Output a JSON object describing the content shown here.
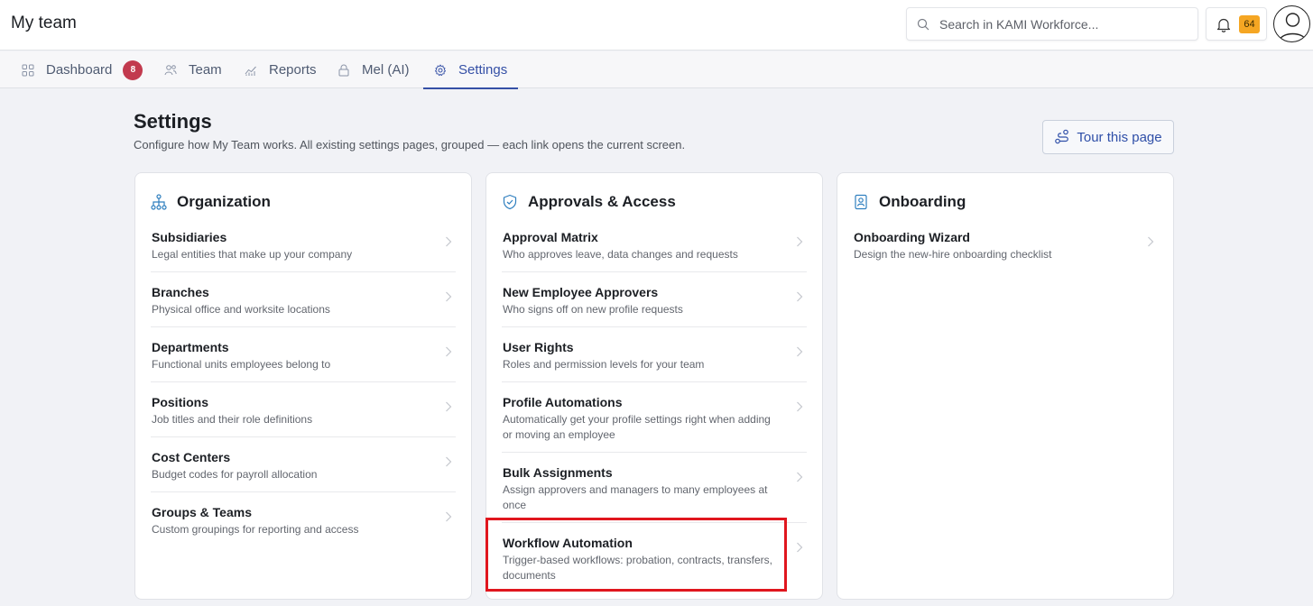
{
  "app": {
    "title": "My team"
  },
  "search": {
    "placeholder": "Search in KAMI Workforce..."
  },
  "notifications": {
    "count": "64"
  },
  "tabs": [
    {
      "label": "Dashboard",
      "icon": "grid-icon",
      "badge": "8"
    },
    {
      "label": "Team",
      "icon": "people-icon"
    },
    {
      "label": "Reports",
      "icon": "bar-chart-icon"
    },
    {
      "label": "Mel (AI)",
      "icon": "lock-icon"
    },
    {
      "label": "Settings",
      "icon": "gear-icon",
      "active": true
    }
  ],
  "page": {
    "title": "Settings",
    "subtitle": "Configure how My Team works. All existing settings pages, grouped — each link opens the current screen.",
    "tour_label": "Tour this page"
  },
  "cards": [
    {
      "title": "Organization",
      "icon": "org-chart-icon",
      "items": [
        {
          "title": "Subsidiaries",
          "desc": "Legal entities that make up your company"
        },
        {
          "title": "Branches",
          "desc": "Physical office and worksite locations"
        },
        {
          "title": "Departments",
          "desc": "Functional units employees belong to"
        },
        {
          "title": "Positions",
          "desc": "Job titles and their role definitions"
        },
        {
          "title": "Cost Centers",
          "desc": "Budget codes for payroll allocation"
        },
        {
          "title": "Groups & Teams",
          "desc": "Custom groupings for reporting and access"
        }
      ]
    },
    {
      "title": "Approvals & Access",
      "icon": "shield-check-icon",
      "items": [
        {
          "title": "Approval Matrix",
          "desc": "Who approves leave, data changes and requests"
        },
        {
          "title": "New Employee Approvers",
          "desc": "Who signs off on new profile requests"
        },
        {
          "title": "User Rights",
          "desc": "Roles and permission levels for your team"
        },
        {
          "title": "Profile Automations",
          "desc": "Automatically get your profile settings right when adding or moving an employee"
        },
        {
          "title": "Bulk Assignments",
          "desc": "Assign approvers and managers to many employees at once"
        },
        {
          "title": "Workflow Automation",
          "desc": "Trigger-based workflows: probation, contracts, transfers, documents"
        }
      ]
    },
    {
      "title": "Onboarding",
      "icon": "id-badge-icon",
      "items": [
        {
          "title": "Onboarding Wizard",
          "desc": "Design the new-hire onboarding checklist"
        }
      ]
    }
  ],
  "colors": {
    "accent": "#3550a6",
    "badge_red": "#c23a4e",
    "notification_badge": "#f5a623",
    "highlight": "#e0161e"
  }
}
